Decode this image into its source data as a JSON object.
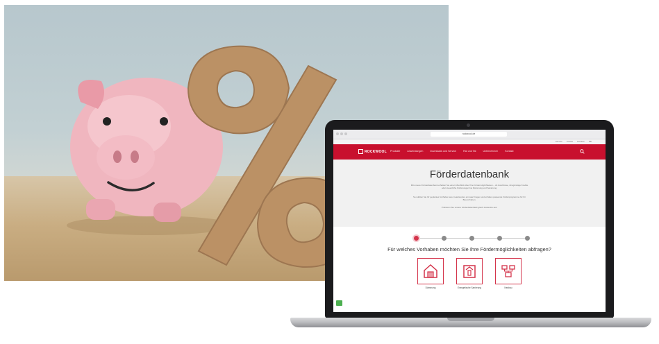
{
  "browser": {
    "url": "rockwool.de"
  },
  "site": {
    "brand": "ROCKWOOL",
    "meta_links": [
      "Service",
      "Presse",
      "Karriere",
      "DE"
    ],
    "nav": [
      "Produkte",
      "Anwendungen",
      "Downloads und Service",
      "Rat und Tat",
      "Unternehmen",
      "Kontakt"
    ]
  },
  "hero": {
    "title": "Förderdatenbank",
    "paragraph1": "Mit unserer Förderdatenbank erhalten Sie einen Überblick über Ihre Fördermöglichkeiten – ob Zuschüsse, zinsgünstige Kredite oder steuerliche Förderungen bei Dämmung und Sanierung.",
    "paragraph2": "So wählen Sie Ihr geplantes Vorhaben aus, beantworten ein paar Fragen und erhalten passende Förderprogramme für Ihr Bauvorhaben.",
    "paragraph3": "Probieren Sie unsere Förderdatenbank gleich kostenlos aus."
  },
  "wizard": {
    "steps_total": 5,
    "active_step": 1,
    "question": "Für welches Vorhaben möchten Sie Ihre Fördermöglichkeiten abfragen?",
    "options": [
      {
        "label": "Dämmung",
        "icon": "house-icon"
      },
      {
        "label": "Energetische Sanierung",
        "icon": "renovation-house-icon"
      },
      {
        "label": "Neubau",
        "icon": "blueprint-icon"
      }
    ]
  },
  "colors": {
    "brand_red": "#c8102e",
    "accent_red": "#d4344b",
    "hero_bg": "#f1f1f1"
  }
}
